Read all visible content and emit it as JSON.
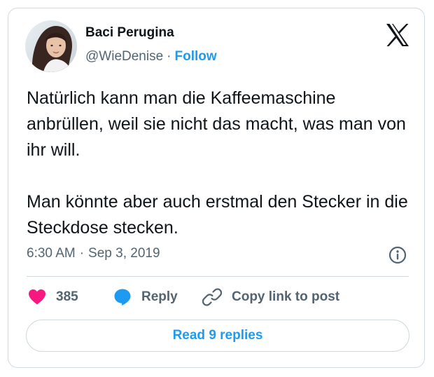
{
  "author": {
    "name": "Baci Perugina",
    "handle": "@WieDenise",
    "separator": "·",
    "follow_label": "Follow"
  },
  "tweet": {
    "paragraphs": [
      "Natürlich kann man die Kaffeemaschine anbrüllen, weil sie nicht das macht, was man von ihr will.",
      "Man könnte aber auch erstmal den Stecker in die Steckdose stecken."
    ],
    "time": "6:30 AM",
    "separator": "·",
    "date": "Sep 3, 2019"
  },
  "actions": {
    "like_count": "385",
    "reply_label": "Reply",
    "copy_label": "Copy link to post"
  },
  "read_replies_label": "Read 9 replies",
  "icons": {
    "brand": "x-logo-icon",
    "info": "info-icon",
    "like": "heart-icon",
    "reply": "speech-bubble-icon",
    "copy": "link-icon"
  },
  "colors": {
    "accent": "#1d9bf0",
    "like": "#f91880",
    "secondary_text": "#536471",
    "primary_text": "#0f1419",
    "border": "#cfd9de"
  }
}
